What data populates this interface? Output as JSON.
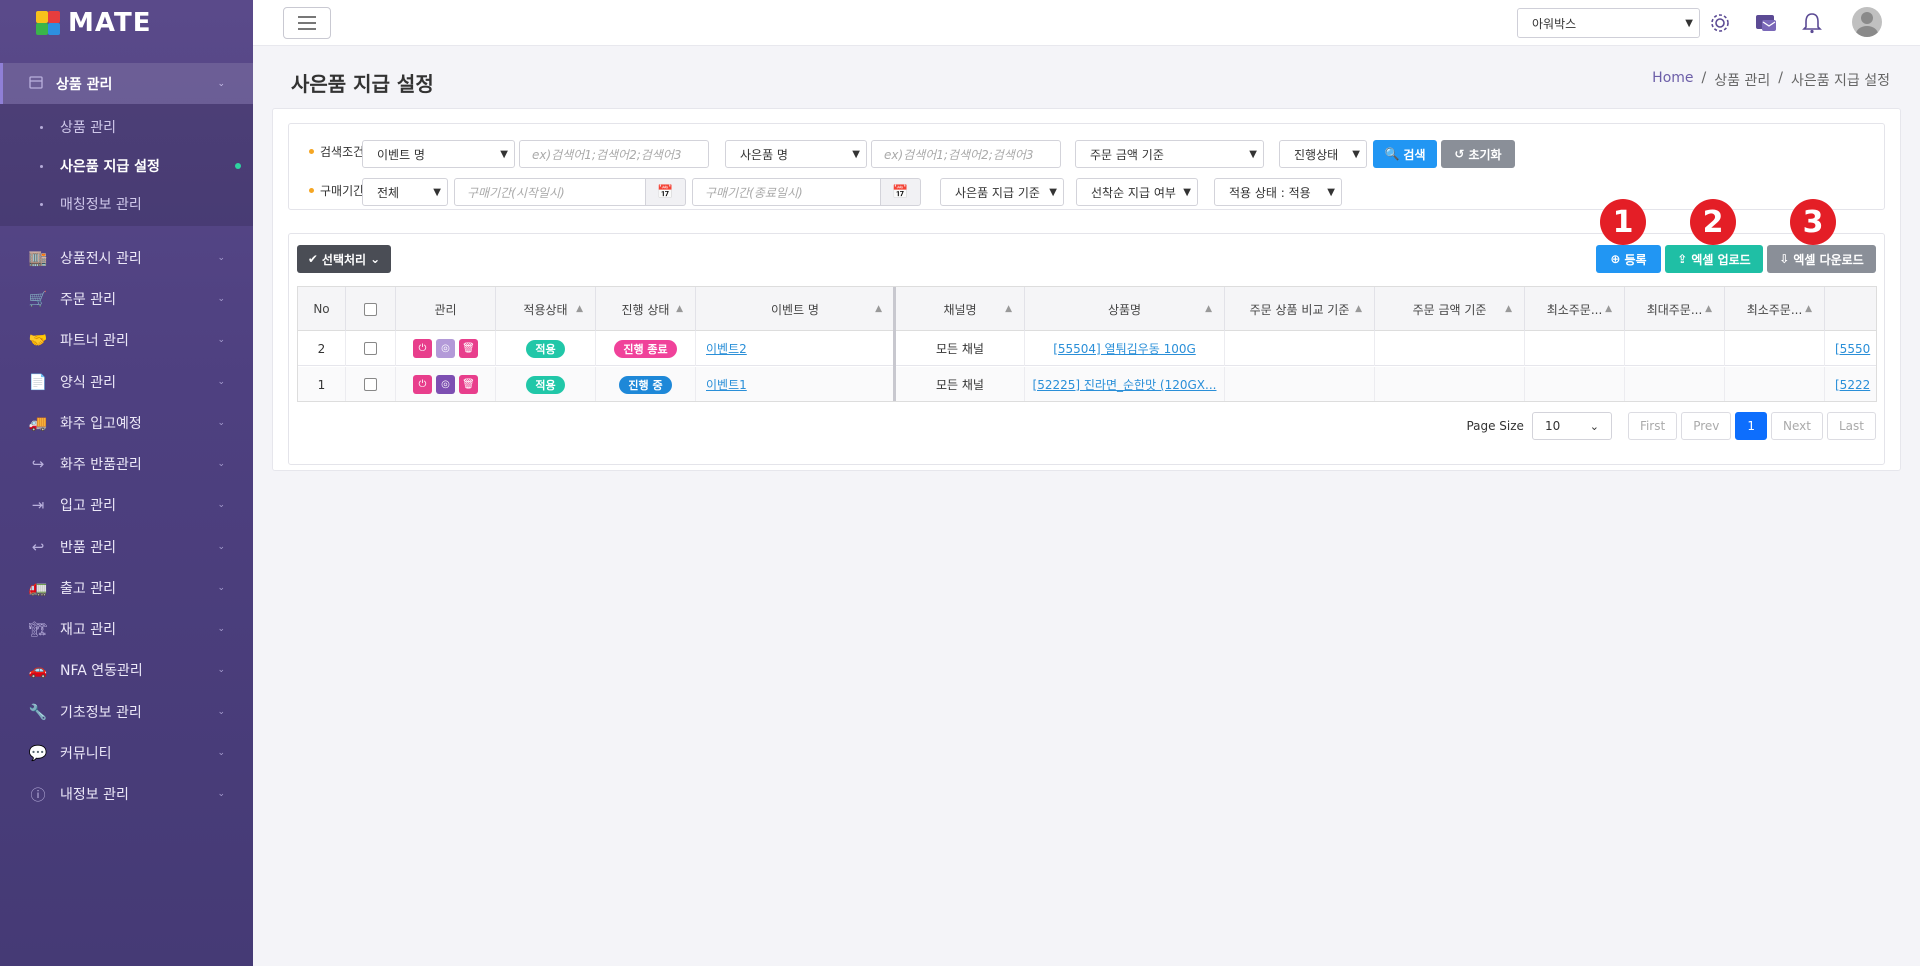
{
  "brand": {
    "name": "MATE"
  },
  "sidebar": {
    "active_section": {
      "label": "상품 관리"
    },
    "sub_items": [
      {
        "label": "상품 관리"
      },
      {
        "label": "사은품 지급 설정"
      },
      {
        "label": "매칭정보 관리"
      }
    ],
    "items": [
      {
        "label": "상품전시 관리"
      },
      {
        "label": "주문 관리"
      },
      {
        "label": "파트너 관리"
      },
      {
        "label": "양식 관리"
      },
      {
        "label": "화주 입고예정"
      },
      {
        "label": "화주 반품관리"
      },
      {
        "label": "입고 관리"
      },
      {
        "label": "반품 관리"
      },
      {
        "label": "출고 관리"
      },
      {
        "label": "재고 관리"
      },
      {
        "label": "NFA 연동관리"
      },
      {
        "label": "기초정보 관리"
      },
      {
        "label": "커뮤니티"
      },
      {
        "label": "내정보 관리"
      }
    ]
  },
  "header": {
    "company": "아워박스"
  },
  "page": {
    "title": "사은품 지급 설정",
    "breadcrumb": [
      "Home",
      "상품 관리",
      "사은품 지급 설정"
    ]
  },
  "search": {
    "row1_label": "검색조건",
    "row2_label": "구매기간",
    "event_field": "이벤트 명",
    "keyword_placeholder": "ex)검색어1;검색어2;검색어3",
    "gift_field": "사은품 명",
    "keyword2_placeholder": "ex)검색어1;검색어2;검색어3",
    "order_amount": "주문 금액 기준",
    "progress": "진행상태",
    "search_btn": "검색",
    "reset_btn": "초기화",
    "period": "전체",
    "start_placeholder": "구매기간(시작일시)",
    "end_placeholder": "구매기간(종료일시)",
    "gift_basis": "사은품 지급 기준",
    "first_come": "선착순 지급 여부",
    "apply_status": "적용 상태 : 적용"
  },
  "toolbar": {
    "batch": "선택처리",
    "register": "등록",
    "excel_upload": "엑셀 업로드",
    "excel_download": "엑셀 다운로드",
    "markers": [
      "1",
      "2",
      "3"
    ]
  },
  "table": {
    "columns": [
      "No",
      "관리",
      "적용상태",
      "진행 상태",
      "이벤트 명",
      "채널명",
      "상품명",
      "주문 상품 비교 기준",
      "주문 금액 기준",
      "최소주문...",
      "최대주문...",
      "최소주문..."
    ],
    "rows": [
      {
        "no": "2",
        "apply": "적용",
        "progress": "진행 종료",
        "event": "이벤트2",
        "channel": "모든 채널",
        "product": "[55504] 열퉈김우동 100G",
        "overflow": "[5550"
      },
      {
        "no": "1",
        "apply": "적용",
        "progress": "진행 중",
        "event": "이벤트1",
        "channel": "모든 채널",
        "product": "[52225] 진라면_순한맛 (120GX...",
        "overflow": "[5222"
      }
    ]
  },
  "pager": {
    "size_label": "Page Size",
    "size": "10",
    "first": "First",
    "prev": "Prev",
    "current": "1",
    "next": "Next",
    "last": "Last"
  },
  "colors": {
    "sidebar": "#4e4080",
    "blue": "#2196f3",
    "teal": "#1fbfa5",
    "pill_green": "#21c7a8",
    "pill_pink": "#f0429a",
    "pill_blue": "#1e88d8",
    "marker": "#e41e26"
  }
}
